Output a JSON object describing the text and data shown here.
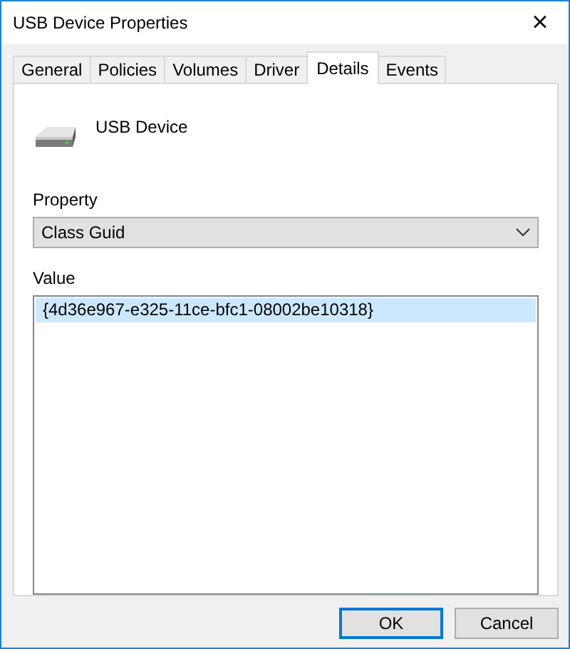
{
  "window": {
    "title": "USB Device Properties",
    "close": "×"
  },
  "tabs": [
    {
      "label": "General",
      "selected": false
    },
    {
      "label": "Policies",
      "selected": false
    },
    {
      "label": "Volumes",
      "selected": false
    },
    {
      "label": "Driver",
      "selected": false
    },
    {
      "label": "Details",
      "selected": true
    },
    {
      "label": "Events",
      "selected": false
    }
  ],
  "device_name": "USB Device",
  "property": {
    "label": "Property",
    "value": "Class Guid"
  },
  "value_list": {
    "label": "Value",
    "items": [
      {
        "text": "{4d36e967-e325-11ce-bfc1-08002be10318}",
        "selected": true
      }
    ]
  },
  "buttons": [
    {
      "label": "OK",
      "default": true
    },
    {
      "label": "Cancel",
      "default": false
    }
  ]
}
